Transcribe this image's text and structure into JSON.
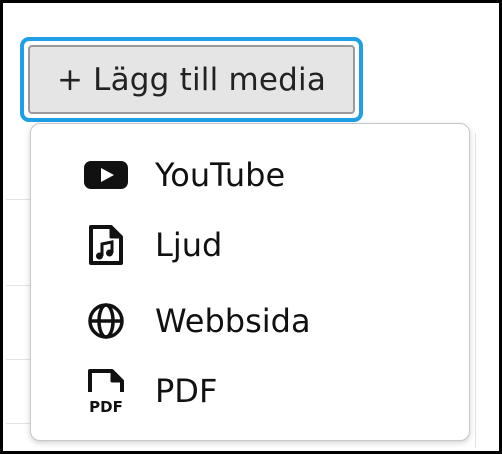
{
  "add_media": {
    "plus": "+",
    "label": "Lägg till media",
    "focus_color": "#1e9fe6"
  },
  "menu": {
    "items": [
      {
        "label": "YouTube",
        "icon": "youtube-icon"
      },
      {
        "label": "Ljud",
        "icon": "audio-file-icon"
      },
      {
        "label": "Webbsida",
        "icon": "globe-icon"
      },
      {
        "label": "PDF",
        "icon": "pdf-file-icon"
      }
    ],
    "pdf_icon_text": "PDF"
  }
}
